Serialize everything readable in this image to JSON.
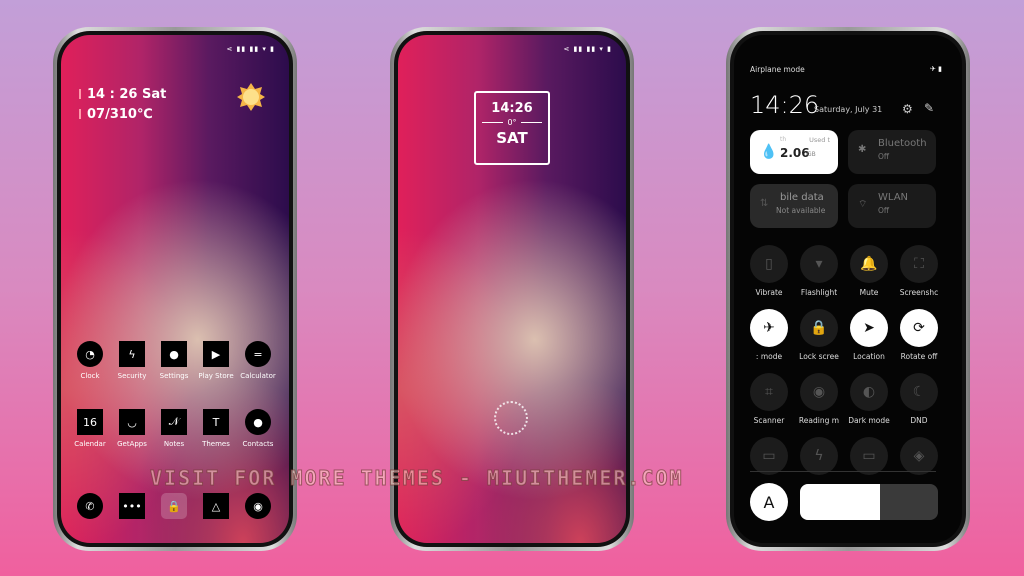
{
  "status_icons": "⋖ ▮▮ ▮▮ ▾ ▮",
  "home": {
    "time": "14 : 26 Sat",
    "weather": "07/310℃",
    "weather_icon": "sun-icon",
    "row1": [
      {
        "label": "Clock",
        "icon": "◔"
      },
      {
        "label": "Security",
        "icon": "ϟ"
      },
      {
        "label": "Settings",
        "icon": "●"
      },
      {
        "label": "Play Store",
        "icon": "▶"
      },
      {
        "label": "Calculator",
        "icon": "="
      }
    ],
    "row2": [
      {
        "label": "Calendar",
        "icon": "16"
      },
      {
        "label": "GetApps",
        "icon": "◡"
      },
      {
        "label": "Notes",
        "icon": "𝒩"
      },
      {
        "label": "Themes",
        "icon": "T"
      },
      {
        "label": "Contacts",
        "icon": "●"
      }
    ],
    "dock": [
      {
        "name": "phone",
        "icon": "✆"
      },
      {
        "name": "messages",
        "icon": "•••"
      },
      {
        "name": "lock",
        "icon": "🔒"
      },
      {
        "name": "gallery",
        "icon": "△"
      },
      {
        "name": "camera",
        "icon": "◉"
      }
    ]
  },
  "lock": {
    "time": "14:26",
    "temp": "0°",
    "day": "SAT"
  },
  "control_center": {
    "header": "Airplane mode",
    "header_icons": "✈ ▮",
    "time": "14:26",
    "date": "Saturday, July 31",
    "data_tile": {
      "label_left": "th",
      "label_right": "Used t",
      "value": "2.06",
      "unit": "GB"
    },
    "bluetooth": {
      "label": "Bluetooth",
      "state": "Off"
    },
    "mobile_data": {
      "label": "bile data",
      "state": "Not available"
    },
    "wlan": {
      "label": "WLAN",
      "state": "Off"
    },
    "toggles": [
      {
        "label": "Vibrate",
        "icon": "▯",
        "on": false
      },
      {
        "label": "Flashlight",
        "icon": "▾",
        "on": false
      },
      {
        "label": "Mute",
        "icon": "🔔",
        "on": false
      },
      {
        "label": "Screenshc",
        "icon": "⛶",
        "on": false
      },
      {
        "label": ": mode",
        "icon": "✈",
        "on": true
      },
      {
        "label": "Lock scree",
        "icon": "🔒",
        "on": false
      },
      {
        "label": "Location",
        "icon": "➤",
        "on": true
      },
      {
        "label": "Rotate off",
        "icon": "⟳",
        "on": true
      },
      {
        "label": "Scanner",
        "icon": "⌗",
        "on": false
      },
      {
        "label": "Reading m",
        "icon": "◉",
        "on": false
      },
      {
        "label": "Dark mode",
        "icon": "◐",
        "on": false
      },
      {
        "label": "DND",
        "icon": "☾",
        "on": false
      },
      {
        "label": "",
        "icon": "▭",
        "on": false
      },
      {
        "label": "",
        "icon": "ϟ",
        "on": false
      },
      {
        "label": "",
        "icon": "▭",
        "on": false
      },
      {
        "label": "",
        "icon": "◈",
        "on": false
      }
    ],
    "auto_brightness": "A",
    "brightness_percent": 58
  },
  "watermark": "VISIT FOR MORE THEMES - MIUITHEMER.COM"
}
